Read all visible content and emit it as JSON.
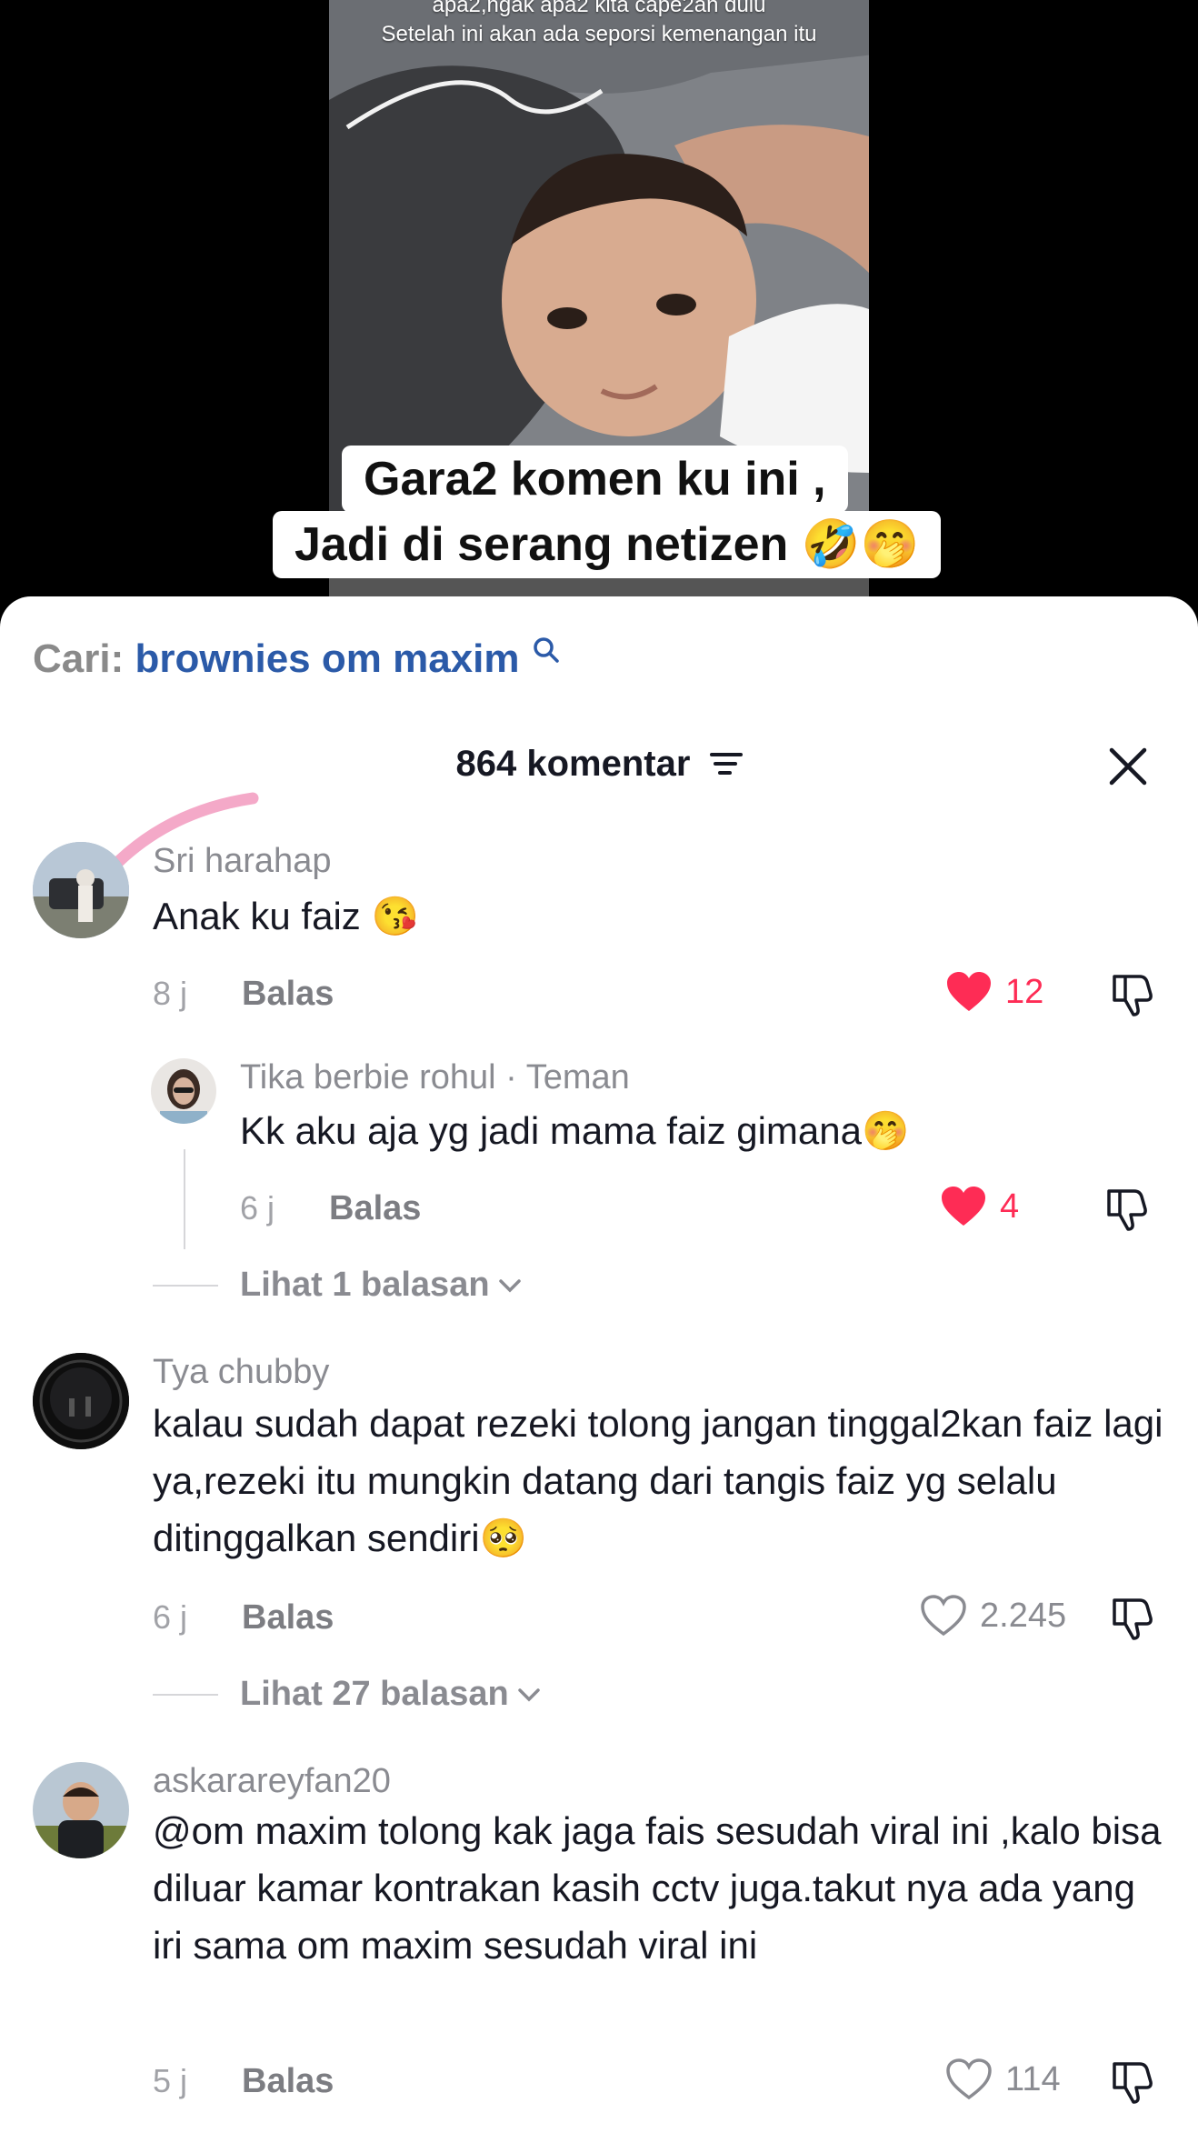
{
  "video": {
    "caption_top_1": "apa2,ngak apa2 kita cape2an dulu",
    "caption_top_2": "Setelah ini akan ada seporsi kemenangan itu",
    "overlay_line_1": "Gara2 komen ku ini ,",
    "overlay_line_2": "Jadi di serang netizen 🤣🤭"
  },
  "search": {
    "label": "Cari:",
    "query": "brownies om maxim"
  },
  "header": {
    "comment_count": "864 komentar"
  },
  "comments": [
    {
      "username": "Sri harahap",
      "text": "Anak ku faiz 😘",
      "time": "8 j",
      "reply_label": "Balas",
      "likes": "12",
      "liked": true
    },
    {
      "username": "Tya chubby",
      "text": "kalau sudah dapat rezeki tolong jangan tinggal2kan faiz lagi ya,rezeki itu mungkin datang dari tangis faiz yg selalu ditinggalkan sendiri🥺",
      "time": "6 j",
      "reply_label": "Balas",
      "likes": "2.245",
      "liked": false,
      "view_replies": "Lihat 27 balasan"
    },
    {
      "username": "askarareyfan20",
      "text": "@om maxim tolong kak jaga fais sesudah viral ini ,kalo bisa diluar kamar kontrakan kasih cctv juga.takut nya ada yang iri sama om maxim sesudah viral ini",
      "time": "5 j",
      "reply_label": "Balas",
      "likes": "114",
      "liked": false
    }
  ],
  "reply": {
    "username": "Tika berbie rohul · Teman",
    "text": "Kk aku aja yg jadi mama faiz gimana🤭",
    "time": "6 j",
    "reply_label": "Balas",
    "likes": "4",
    "liked": true,
    "view_replies": "Lihat 1 balasan"
  },
  "colors": {
    "accent": "#fe2c55",
    "link": "#2b5aa8",
    "meta": "#8a8b91"
  }
}
